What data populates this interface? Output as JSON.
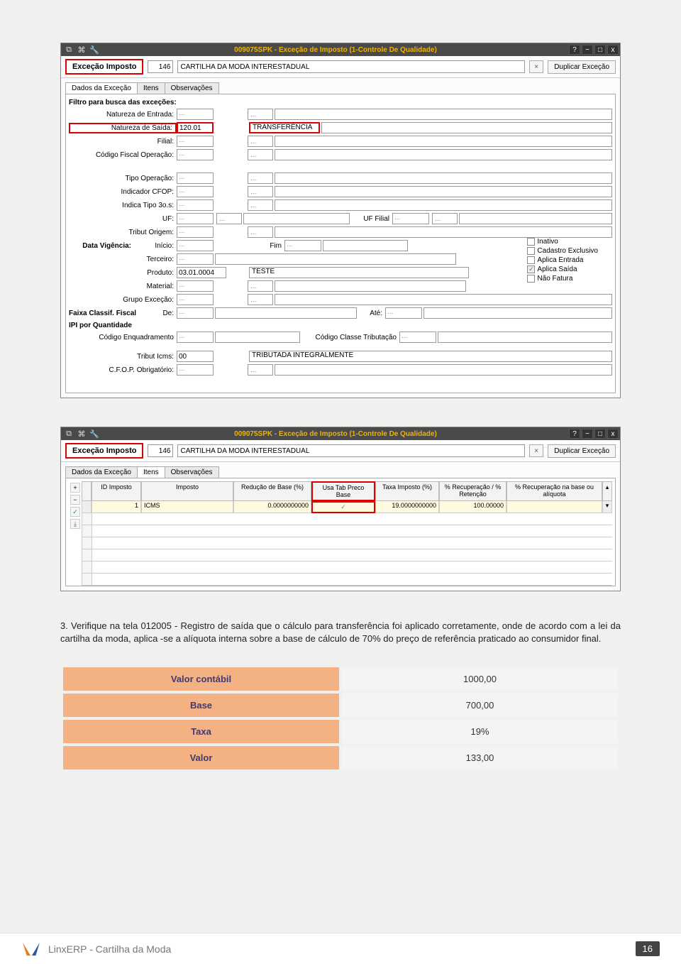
{
  "window1": {
    "title": "009075SPK - Exceção de Imposto (1-Controle De Qualidade)",
    "header_label": "Exceção Imposto",
    "code": "146",
    "name": "CARTILHA DA MODA INTERESTADUAL",
    "clear": "×",
    "dup_btn": "Duplicar Exceção",
    "tabs": [
      "Dados da Exceção",
      "Itens",
      "Observações"
    ],
    "filter_title": "Filtro para busca das exceções:",
    "labels": {
      "nat_entrada": "Natureza de Entrada:",
      "nat_saida": "Natureza de Saída:",
      "filial": "Filial:",
      "cfop": "Código Fiscal Operação:",
      "tipo_op": "Tipo Operação:",
      "ind_cfop": "Indicador CFOP:",
      "ind_3os": "Indica Tipo 3o.s:",
      "uf": "UF:",
      "uf_filial": "UF Filial",
      "trib_origem": "Tribut Origem:",
      "data_vig": "Data Vigência:",
      "inicio": "Início:",
      "fim": "Fim",
      "terceiro": "Terceiro:",
      "produto": "Produto:",
      "material": "Material:",
      "grupo_exc": "Grupo Exceção:",
      "faixa": "Faixa Classif. Fiscal",
      "de": "De:",
      "ate": "Até:",
      "ipi": "IPI por Quantidade",
      "cod_enq": "Código Enquadramento",
      "cod_classe": "Código Classe Tributação",
      "trib_icms": "Tribut Icms:",
      "cfop_ob": "C.F.O.P. Obrigatório:"
    },
    "values": {
      "nat_saida_code": "120.01",
      "nat_saida_desc": "TRANSFERÊNCIA",
      "produto_code": "03.01.0004",
      "produto_desc": "TESTE",
      "trib_icms_code": "00",
      "trib_icms_desc": "TRIBUTADA INTEGRALMENTE"
    },
    "dots": "...",
    "checks": {
      "inativo": "Inativo",
      "cad_exc": "Cadastro Exclusivo",
      "ap_ent": "Aplica Entrada",
      "ap_sai": "Aplica Saída",
      "nao_fat": "Não Fatura"
    }
  },
  "window2": {
    "title": "009075SPK - Exceção de Imposto (1-Controle De Qualidade)",
    "header_label": "Exceção Imposto",
    "code": "146",
    "name": "CARTILHA DA MODA INTERESTADUAL",
    "clear": "×",
    "dup_btn": "Duplicar Exceção",
    "tabs": [
      "Dados da Exceção",
      "Itens",
      "Observações"
    ],
    "headers": [
      "ID Imposto",
      "Imposto",
      "Redução de Base (%)",
      "Usa Tab Preco Base",
      "Taxa Imposto (%)",
      "% Recuperação / % Retenção",
      "% Recuperação na base ou alíquota"
    ],
    "row": {
      "id": "1",
      "imposto": "ICMS",
      "reducao": "0.0000000000",
      "usa_tab": "✓",
      "taxa": "19.0000000000",
      "recup": "100.00000",
      "recup_base": ""
    }
  },
  "paragraph": "3. Verifique na tela 012005 - Registro de saída que o cálculo para transferência foi aplicado corretamente, onde de acordo com a lei da cartilha da moda, aplica -se a alíquota interna sobre a base de cálculo de 70% do preço de referência praticado ao consumidor final.",
  "summary": [
    {
      "label": "Valor contábil",
      "value": "1000,00"
    },
    {
      "label": "Base",
      "value": "700,00"
    },
    {
      "label": "Taxa",
      "value": "19%"
    },
    {
      "label": "Valor",
      "value": "133,00"
    }
  ],
  "chart_data": {
    "type": "table",
    "title": "",
    "rows": [
      [
        "Valor contábil",
        "1000,00"
      ],
      [
        "Base",
        "700,00"
      ],
      [
        "Taxa",
        "19%"
      ],
      [
        "Valor",
        "133,00"
      ]
    ]
  },
  "footer": {
    "text": "LinxERP - Cartilha da Moda",
    "page": "16",
    "logo_text": "LINX"
  }
}
